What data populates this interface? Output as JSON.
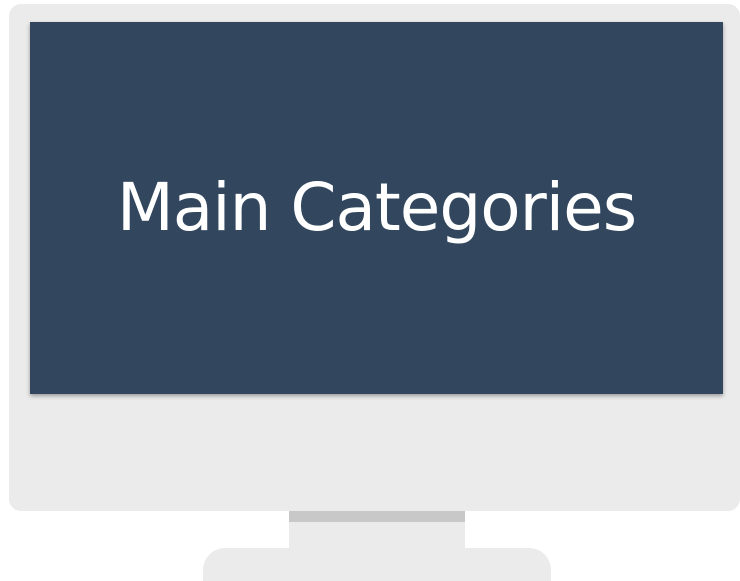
{
  "screen": {
    "title": "Main Categories",
    "background_color": "#32475e",
    "text_color": "#ffffff"
  },
  "monitor": {
    "frame_color": "#ebebeb"
  }
}
